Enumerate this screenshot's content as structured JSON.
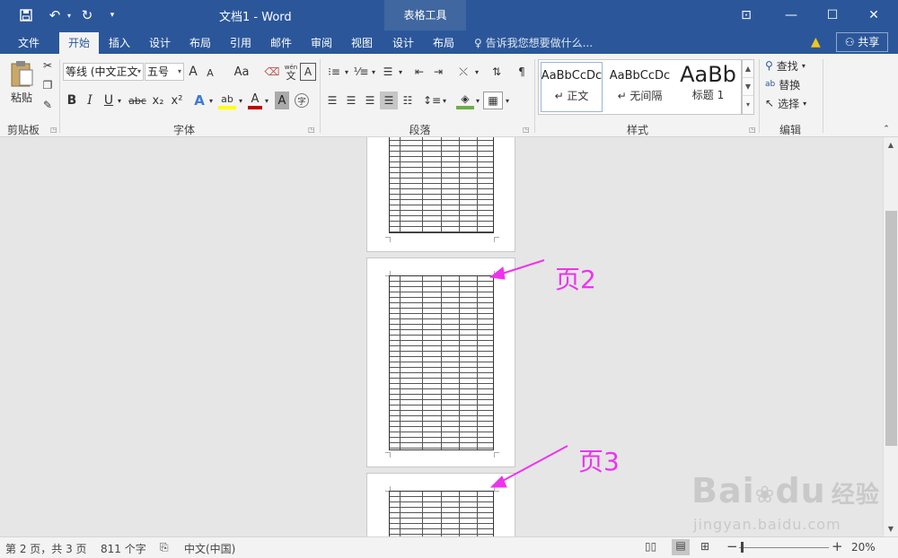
{
  "titlebar": {
    "title": "文档1 - Word",
    "context_tab": "表格工具",
    "quick_access": {
      "save_icon": "save-icon",
      "undo_icon": "undo-icon",
      "redo_icon": "redo-icon",
      "customize_icon": "customize-qat-icon"
    },
    "window_controls": [
      "ribbon-display-options-icon",
      "minimize-icon",
      "maximize-icon",
      "close-icon"
    ]
  },
  "tabs": {
    "items": [
      "文件",
      "开始",
      "插入",
      "设计",
      "布局",
      "引用",
      "邮件",
      "审阅",
      "视图",
      "设计",
      "布局"
    ],
    "active": "开始",
    "tell_me": "告诉我您想要做什么...",
    "share": "共享"
  },
  "ribbon": {
    "clipboard": {
      "paste": "粘贴",
      "label": "剪贴板"
    },
    "font": {
      "font_name": "等线 (中文正文",
      "font_size": "五号",
      "case_button": "Aa",
      "label": "字体",
      "bold": "B",
      "italic": "I",
      "underline": "U",
      "strikethrough": "abc",
      "subscript": "x₂",
      "superscript": "x²",
      "phonetic": "wén",
      "phonetic_char": "文",
      "char_border": "A",
      "grow": "A",
      "shrink": "A",
      "color_a": "A",
      "highlight": "ab",
      "shading": "A",
      "enclose": "字"
    },
    "paragraph": {
      "label": "段落"
    },
    "styles": {
      "label": "样式",
      "items": [
        {
          "sample": "AaBbCcDc",
          "name": "↵ 正文"
        },
        {
          "sample": "AaBbCcDc",
          "name": "↵ 无间隔"
        },
        {
          "sample": "AaBb",
          "name": "标题 1"
        }
      ]
    },
    "editing": {
      "find": "查找",
      "replace": "替换",
      "select": "选择",
      "label": "编辑"
    }
  },
  "document": {
    "annotations": [
      "页2",
      "页3"
    ],
    "annotation_color": "#ee33ee"
  },
  "watermark": {
    "brand": "Bai",
    "brand2": "du",
    "cn": "经验",
    "url": "jingyan.baidu.com"
  },
  "statusbar": {
    "page": "第 2 页，共 3 页",
    "words": "811 个字",
    "language": "中文(中国)",
    "zoom": "20%",
    "zoom_minus": "−",
    "zoom_plus": "+"
  },
  "colors": {
    "brand": "#2b579a",
    "ribbon": "#f3f3f3",
    "canvas": "#e6e6e6"
  }
}
